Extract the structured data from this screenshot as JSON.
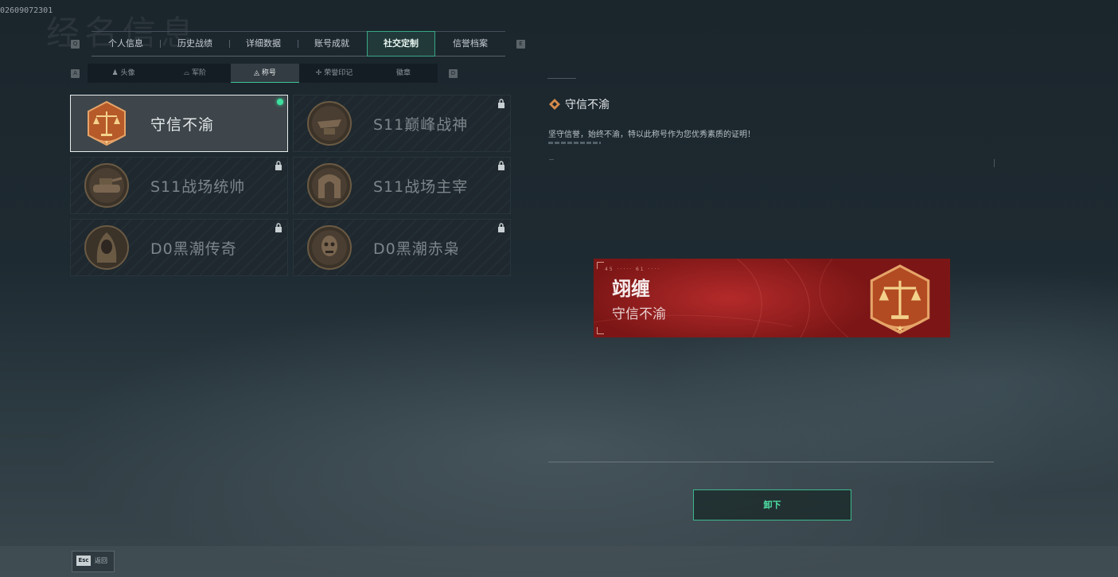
{
  "uid": "02609072301",
  "bg_title": "经名信息",
  "main_tabs": {
    "left_key": "Q",
    "right_key": "E",
    "items": [
      {
        "label": "个人信息"
      },
      {
        "label": "历史战绩"
      },
      {
        "label": "详细数据"
      },
      {
        "label": "账号成就"
      },
      {
        "label": "社交定制",
        "active": true
      },
      {
        "label": "信誉档案"
      }
    ]
  },
  "sub_tabs": {
    "left_key": "A",
    "right_key": "D",
    "items": [
      {
        "label": "头像",
        "icon": "person-icon"
      },
      {
        "label": "军阶",
        "icon": "rank-icon"
      },
      {
        "label": "称号",
        "icon": "title-icon",
        "active": true
      },
      {
        "label": "荣誉印记",
        "icon": "honor-icon"
      },
      {
        "label": "徽章",
        "icon": "badge-icon"
      }
    ]
  },
  "titles": [
    {
      "name": "守信不渝",
      "selected": true,
      "equipped": true,
      "locked": false,
      "emblem": "scales-emblem"
    },
    {
      "name": "S11巅峰战神",
      "selected": false,
      "locked": true,
      "emblem": "anvil-emblem"
    },
    {
      "name": "S11战场统帅",
      "selected": false,
      "locked": true,
      "emblem": "tank-emblem"
    },
    {
      "name": "S11战场主宰",
      "selected": false,
      "locked": true,
      "emblem": "arch-emblem"
    },
    {
      "name": "D0黑潮传奇",
      "selected": false,
      "locked": true,
      "emblem": "hooded-figure-emblem"
    },
    {
      "name": "D0黑潮赤枭",
      "selected": false,
      "locked": true,
      "emblem": "skull-mask-emblem"
    }
  ],
  "detail": {
    "title": "守信不渝",
    "description": "坚守信誉，始终不渝，特以此称号作为您优秀素质的证明！"
  },
  "banner": {
    "player_name": "翊缠",
    "title": "守信不渝",
    "code": "45 ····· 61 ····"
  },
  "actions": {
    "unequip_label": "卸下"
  },
  "footer": {
    "esc_key": "Esc",
    "back_label": "返回"
  },
  "colors": {
    "accent": "#3ec494",
    "banner_red": "#b42a2a"
  }
}
